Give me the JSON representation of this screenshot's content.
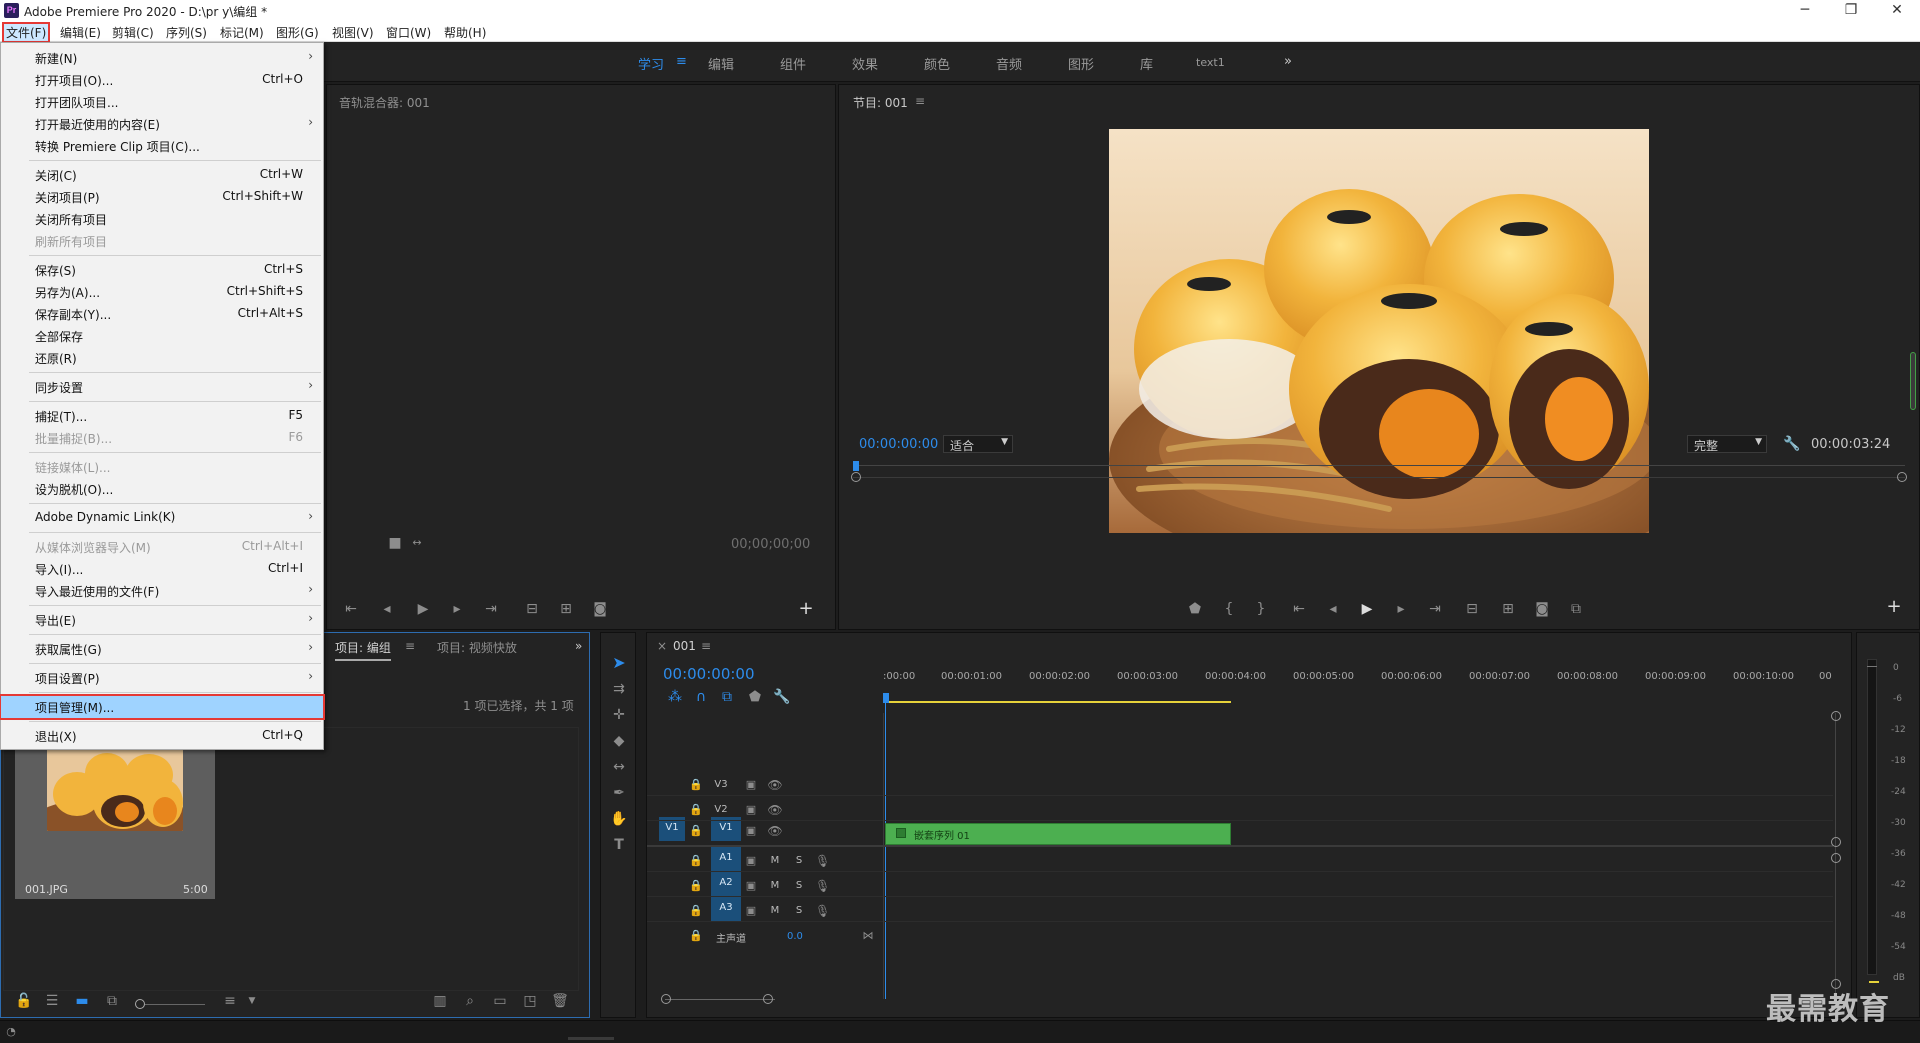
{
  "window": {
    "title": "Adobe Premiere Pro 2020 - D:\\pr y\\编组 *",
    "logo_text": "Pr",
    "minimize": "─",
    "restore": "❐",
    "close": "✕"
  },
  "menubar": [
    "文件(F)",
    "编辑(E)",
    "剪辑(C)",
    "序列(S)",
    "标记(M)",
    "图形(G)",
    "视图(V)",
    "窗口(W)",
    "帮助(H)"
  ],
  "workspaces": [
    "学习",
    "编辑",
    "组件",
    "效果",
    "颜色",
    "音频",
    "图形",
    "库",
    "text1"
  ],
  "workspace_active_menu": "≡",
  "workspace_more": "»",
  "file_menu": [
    {
      "label": "新建(N)",
      "shortcut": "",
      "submenu": true,
      "disabled": false
    },
    {
      "label": "打开项目(O)...",
      "shortcut": "Ctrl+O",
      "submenu": false,
      "disabled": false
    },
    {
      "label": "打开团队项目...",
      "shortcut": "",
      "submenu": false,
      "disabled": false
    },
    {
      "label": "打开最近使用的内容(E)",
      "shortcut": "",
      "submenu": true,
      "disabled": false
    },
    {
      "label": "转换 Premiere Clip 项目(C)...",
      "shortcut": "",
      "submenu": false,
      "disabled": false
    },
    {
      "label": "关闭(C)",
      "shortcut": "Ctrl+W",
      "submenu": false,
      "disabled": false
    },
    {
      "label": "关闭项目(P)",
      "shortcut": "Ctrl+Shift+W",
      "submenu": false,
      "disabled": false
    },
    {
      "label": "关闭所有项目",
      "shortcut": "",
      "submenu": false,
      "disabled": false
    },
    {
      "label": "刷新所有项目",
      "shortcut": "",
      "submenu": false,
      "disabled": true
    },
    {
      "label": "保存(S)",
      "shortcut": "Ctrl+S",
      "submenu": false,
      "disabled": false
    },
    {
      "label": "另存为(A)...",
      "shortcut": "Ctrl+Shift+S",
      "submenu": false,
      "disabled": false
    },
    {
      "label": "保存副本(Y)...",
      "shortcut": "Ctrl+Alt+S",
      "submenu": false,
      "disabled": false
    },
    {
      "label": "全部保存",
      "shortcut": "",
      "submenu": false,
      "disabled": false
    },
    {
      "label": "还原(R)",
      "shortcut": "",
      "submenu": false,
      "disabled": false
    },
    {
      "label": "同步设置",
      "shortcut": "",
      "submenu": true,
      "disabled": false
    },
    {
      "label": "捕捉(T)...",
      "shortcut": "F5",
      "submenu": false,
      "disabled": false
    },
    {
      "label": "批量捕捉(B)...",
      "shortcut": "F6",
      "submenu": false,
      "disabled": true
    },
    {
      "label": "链接媒体(L)...",
      "shortcut": "",
      "submenu": false,
      "disabled": true
    },
    {
      "label": "设为脱机(O)...",
      "shortcut": "",
      "submenu": false,
      "disabled": false
    },
    {
      "label": "Adobe Dynamic Link(K)",
      "shortcut": "",
      "submenu": true,
      "disabled": false
    },
    {
      "label": "从媒体浏览器导入(M)",
      "shortcut": "Ctrl+Alt+I",
      "submenu": false,
      "disabled": true
    },
    {
      "label": "导入(I)...",
      "shortcut": "Ctrl+I",
      "submenu": false,
      "disabled": false
    },
    {
      "label": "导入最近使用的文件(F)",
      "shortcut": "",
      "submenu": true,
      "disabled": false
    },
    {
      "label": "导出(E)",
      "shortcut": "",
      "submenu": true,
      "disabled": false
    },
    {
      "label": "获取属性(G)",
      "shortcut": "",
      "submenu": true,
      "disabled": false
    },
    {
      "label": "项目设置(P)",
      "shortcut": "",
      "submenu": true,
      "disabled": false
    },
    {
      "label": "项目管理(M)...",
      "shortcut": "",
      "submenu": false,
      "disabled": false,
      "highlight": true
    },
    {
      "label": "退出(X)",
      "shortcut": "Ctrl+Q",
      "submenu": false,
      "disabled": false
    }
  ],
  "audio_mixer": {
    "title": "音轨混合器: 001",
    "timecode": "00;00;00;00"
  },
  "program_monitor": {
    "title": "节目: 001",
    "menu": "≡",
    "timecode_in": "00:00:00:00",
    "zoom": "适合",
    "quality": "完整",
    "duration": "00:00:03:24"
  },
  "project": {
    "tab_active": "项目: 编组",
    "tab_other": "项目: 视频快放",
    "selection_info": "1 项已选择，共 1 项",
    "clip_name": "001.JPG",
    "clip_duration": "5:00"
  },
  "timeline": {
    "sequence_name": "001",
    "timecode": "00:00:00:00",
    "ruler": [
      ":00:00",
      "00:00:01:00",
      "00:00:02:00",
      "00:00:03:00",
      "00:00:04:00",
      "00:00:05:00",
      "00:00:06:00",
      "00:00:07:00",
      "00:00:08:00",
      "00:00:09:00",
      "00:00:10:00",
      "00"
    ],
    "video_tracks": [
      "V3",
      "V2",
      "V1"
    ],
    "source_patch": "V1",
    "audio_tracks": [
      "A1",
      "A2",
      "A3"
    ],
    "master": "主声道",
    "master_value": "0.0",
    "clip_label": "嵌套序列 01",
    "mute": "M",
    "solo": "S"
  },
  "meter_scale": [
    "0",
    "-6",
    "-12",
    "-18",
    "-24",
    "-30",
    "-36",
    "-42",
    "-48",
    "-54",
    "dB"
  ],
  "watermark": "最需教育",
  "colors": {
    "accent": "#2d8ceb",
    "clip": "#4caf50",
    "highlight_outline": "#e53935"
  }
}
